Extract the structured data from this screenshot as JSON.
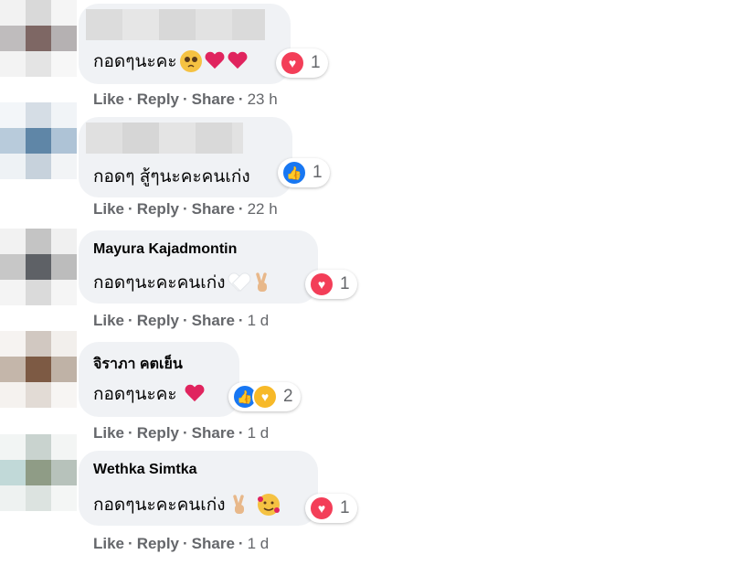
{
  "comments": [
    {
      "author": "",
      "text": "กอดๆนะคะ",
      "emojis": [
        "pleading-face-icon",
        "red-heart-icon",
        "red-heart-icon"
      ],
      "reactions": [
        "love"
      ],
      "reaction_count": "1",
      "actions": {
        "like": "Like",
        "reply": "Reply",
        "share": "Share",
        "time": "23 h"
      }
    },
    {
      "author": "",
      "text": "กอดๆ สู้ๆนะคะคนเก่ง",
      "emojis": [],
      "reactions": [
        "like"
      ],
      "reaction_count": "1",
      "actions": {
        "like": "Like",
        "reply": "Reply",
        "share": "Share",
        "time": "22 h"
      }
    },
    {
      "author": "Mayura Kajadmontin",
      "text": "กอดๆนะคะคนเก่ง",
      "emojis": [
        "white-heart-icon",
        "victory-hand-icon"
      ],
      "reactions": [
        "love"
      ],
      "reaction_count": "1",
      "actions": {
        "like": "Like",
        "reply": "Reply",
        "share": "Share",
        "time": "1 d"
      }
    },
    {
      "author": "จิราภา คตเย็น",
      "text": "กอดๆนะคะ",
      "emojis": [
        "sparkling-heart-icon"
      ],
      "reactions": [
        "like",
        "care"
      ],
      "reaction_count": "2",
      "actions": {
        "like": "Like",
        "reply": "Reply",
        "share": "Share",
        "time": "1 d"
      }
    },
    {
      "author": "Wethka Simtka",
      "text": "กอดๆนะคะคนเก่ง",
      "emojis": [
        "victory-hand-icon",
        "smiling-face-with-hearts-icon"
      ],
      "reactions": [
        "love"
      ],
      "reaction_count": "1",
      "actions": {
        "like": "Like",
        "reply": "Reply",
        "share": "Share",
        "time": "1 d"
      }
    }
  ],
  "colors": {
    "bubble": "#f0f2f5",
    "action_text": "#65676b",
    "love": "#f33e58",
    "like": "#1877f2",
    "care": "#f7b928"
  }
}
